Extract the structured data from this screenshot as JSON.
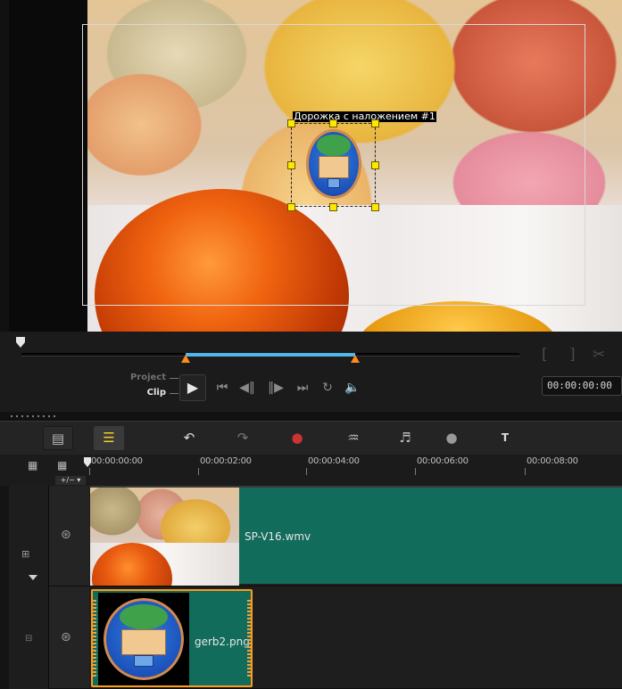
{
  "preview": {
    "overlay_label": "Дорожка с наложением #1",
    "colors": {
      "handle": "#ffe800",
      "safe_area": "#d8d8d8"
    }
  },
  "playback": {
    "project_label": "Project",
    "clip_label": "Clip",
    "timecode": "00:00:00:00",
    "bracket_in": "[",
    "bracket_out": "]",
    "scissors": "✂",
    "controls": {
      "play": "▶",
      "home": "⏮",
      "prev_frame": "◀‖",
      "next_frame": "‖▶",
      "end": "⏭",
      "repeat": "↻",
      "volume": "🔈"
    },
    "colors": {
      "range": "#52b6ea",
      "trim_marker": "#ff8a1a"
    }
  },
  "toolbar": {
    "storyboard_icon": "▤",
    "timeline_icon": "☰",
    "undo_icon": "↶",
    "redo_icon": "↷",
    "record_icon": "●",
    "audio_mixer_icon": "♒",
    "auto_music_icon": "♬",
    "motion_icon": "●",
    "subtitle_icon": "T"
  },
  "ruler": {
    "plusminus": "+/− ▾",
    "ticks": [
      "00:00:00:00",
      "00:00:02:00",
      "00:00:04:00",
      "00:00:06:00",
      "00:00:08:00"
    ]
  },
  "tracks": {
    "video": {
      "clip_name": "SP-V16.wmv",
      "color": "#126c5c"
    },
    "overlay": {
      "clip_name": "gerb2.png",
      "border_color": "#ff9a1a"
    }
  }
}
